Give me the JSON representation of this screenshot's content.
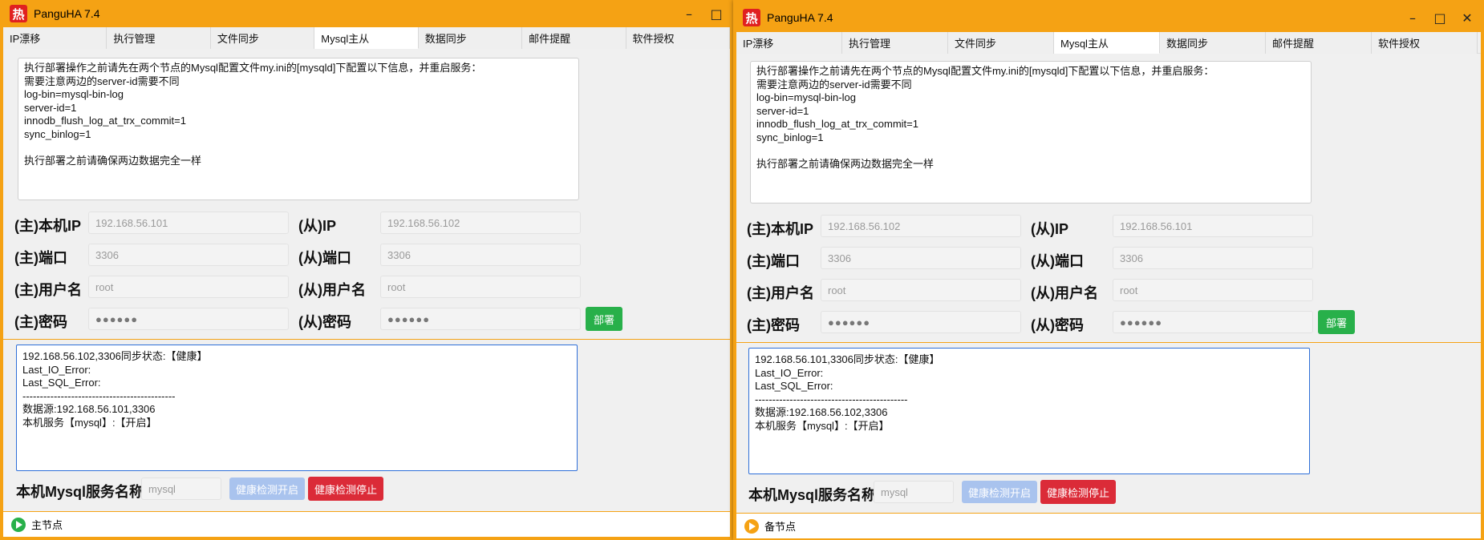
{
  "windows": [
    {
      "title": "PanguHA 7.4",
      "tabs": [
        "IP漂移",
        "执行管理",
        "文件同步",
        "Mysql主从",
        "数据同步",
        "邮件提醒",
        "软件授权"
      ],
      "active_tab": "Mysql主从",
      "notes": "执行部署操作之前请先在两个节点的Mysql配置文件my.ini的[mysqld]下配置以下信息，并重启服务：\n需要注意两边的server-id需要不同\nlog-bin=mysql-bin-log\nserver-id=1\ninnodb_flush_log_at_trx_commit=1\nsync_binlog=1\n\n执行部署之前请确保两边数据完全一样",
      "form": {
        "master_ip_label": "(主)本机IP",
        "master_ip": "192.168.56.101",
        "slave_ip_label": "(从)IP",
        "slave_ip": "192.168.56.102",
        "master_port_label": "(主)端口",
        "master_port": "3306",
        "slave_port_label": "(从)端口",
        "slave_port": "3306",
        "master_user_label": "(主)用户名",
        "master_user": "root",
        "slave_user_label": "(从)用户名",
        "slave_user": "root",
        "master_pwd_label": "(主)密码",
        "master_pwd": "●●●●●●",
        "slave_pwd_label": "(从)密码",
        "slave_pwd": "●●●●●●",
        "deploy_label": "部署"
      },
      "log": "192.168.56.102,3306同步状态:【健康】\nLast_IO_Error:\nLast_SQL_Error:\n--------------------------------------------\n数据源:192.168.56.101,3306\n本机服务【mysql】:【开启】",
      "service": {
        "label": "本机Mysql服务名称",
        "placeholder": "mysql",
        "start_label": "健康检测开启",
        "stop_label": "健康检测停止"
      },
      "status": {
        "text": "主节点",
        "icon_color": "#28b04a"
      }
    },
    {
      "title": "PanguHA 7.4",
      "tabs": [
        "IP漂移",
        "执行管理",
        "文件同步",
        "Mysql主从",
        "数据同步",
        "邮件提醒",
        "软件授权"
      ],
      "active_tab": "Mysql主从",
      "notes": "执行部署操作之前请先在两个节点的Mysql配置文件my.ini的[mysqld]下配置以下信息，并重启服务：\n需要注意两边的server-id需要不同\nlog-bin=mysql-bin-log\nserver-id=1\ninnodb_flush_log_at_trx_commit=1\nsync_binlog=1\n\n执行部署之前请确保两边数据完全一样",
      "form": {
        "master_ip_label": "(主)本机IP",
        "master_ip": "192.168.56.102",
        "slave_ip_label": "(从)IP",
        "slave_ip": "192.168.56.101",
        "master_port_label": "(主)端口",
        "master_port": "3306",
        "slave_port_label": "(从)端口",
        "slave_port": "3306",
        "master_user_label": "(主)用户名",
        "master_user": "root",
        "slave_user_label": "(从)用户名",
        "slave_user": "root",
        "master_pwd_label": "(主)密码",
        "master_pwd": "●●●●●●",
        "slave_pwd_label": "(从)密码",
        "slave_pwd": "●●●●●●",
        "deploy_label": "部署"
      },
      "log": "192.168.56.101,3306同步状态:【健康】\nLast_IO_Error:\nLast_SQL_Error:\n--------------------------------------------\n数据源:192.168.56.102,3306\n本机服务【mysql】:【开启】",
      "service": {
        "label": "本机Mysql服务名称",
        "placeholder": "mysql",
        "start_label": "健康检测开启",
        "stop_label": "健康检测停止"
      },
      "status": {
        "text": "备节点",
        "icon_color": "#f5a214"
      }
    }
  ]
}
